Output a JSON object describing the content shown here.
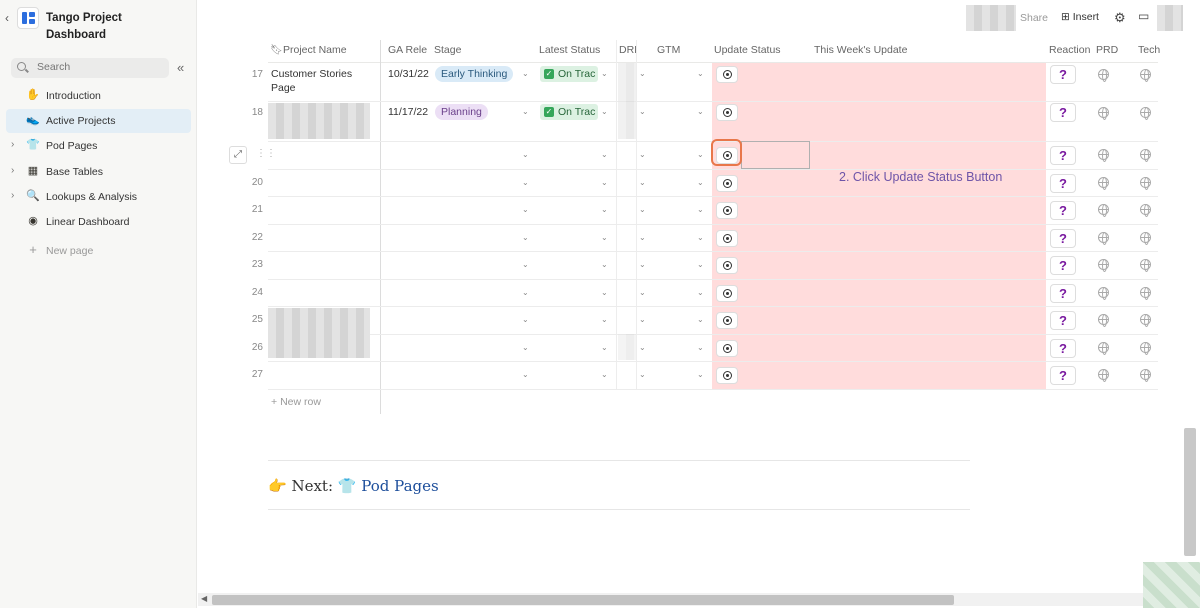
{
  "sidebar": {
    "workspace_title": "Tango Project Dashboard",
    "search_placeholder": "Search",
    "items": [
      {
        "label": "Introduction",
        "icon": "✋",
        "active": false,
        "expandable": false
      },
      {
        "label": "Active Projects",
        "icon": "👟",
        "active": true,
        "expandable": false
      },
      {
        "label": "Pod Pages",
        "icon": "👕",
        "active": false,
        "expandable": true
      },
      {
        "label": "Base Tables",
        "icon": "▦",
        "active": false,
        "expandable": true
      },
      {
        "label": "Lookups & Analysis",
        "icon": "🔍",
        "active": false,
        "expandable": true
      },
      {
        "label": "Linear Dashboard",
        "icon": "◉",
        "active": false,
        "expandable": false
      }
    ],
    "new_page_label": "New page"
  },
  "topbar": {
    "share_label": "Share",
    "insert_label": "Insert"
  },
  "table": {
    "columns": [
      "Project Name",
      "GA Rele",
      "Stage",
      "Latest Status",
      "DRI",
      "GTM",
      "Update Status",
      "This Week's Update",
      "Reaction",
      "PRD",
      "Tech"
    ],
    "rows": [
      {
        "num": "17",
        "project": "Customer Stories Page",
        "ga": "10/31/22",
        "stage": "Early Thinking",
        "stage_color": "blue",
        "status": "On Trac"
      },
      {
        "num": "18",
        "project": "",
        "ga": "11/17/22",
        "stage": "Planning",
        "stage_color": "purple",
        "status": "On Trac"
      },
      {
        "num": "",
        "project": "",
        "ga": "",
        "stage": "",
        "status": ""
      },
      {
        "num": "20",
        "project": "",
        "ga": "",
        "stage": "",
        "status": ""
      },
      {
        "num": "21",
        "project": "",
        "ga": "",
        "stage": "",
        "status": ""
      },
      {
        "num": "22",
        "project": "",
        "ga": "",
        "stage": "",
        "status": ""
      },
      {
        "num": "23",
        "project": "",
        "ga": "",
        "stage": "",
        "status": ""
      },
      {
        "num": "24",
        "project": "",
        "ga": "",
        "stage": "",
        "status": ""
      },
      {
        "num": "25",
        "project": "",
        "ga": "",
        "stage": "",
        "status": ""
      },
      {
        "num": "26",
        "project": "",
        "ga": "",
        "stage": "",
        "status": ""
      },
      {
        "num": "27",
        "project": "",
        "ga": "",
        "stage": "",
        "status": ""
      }
    ],
    "reaction_symbol": "?",
    "new_row_label": "New row"
  },
  "annotation": {
    "text": "2. Click Update Status Button",
    "color": "#6e54a8",
    "highlight_color": "#e8774a"
  },
  "next": {
    "prefix_icon": "👉",
    "prefix": "Next:",
    "link_icon": "👕",
    "link_label": "Pod Pages"
  },
  "colors": {
    "update_column_bg": "#ffdcdc",
    "active_nav_bg": "#e3eef6"
  }
}
